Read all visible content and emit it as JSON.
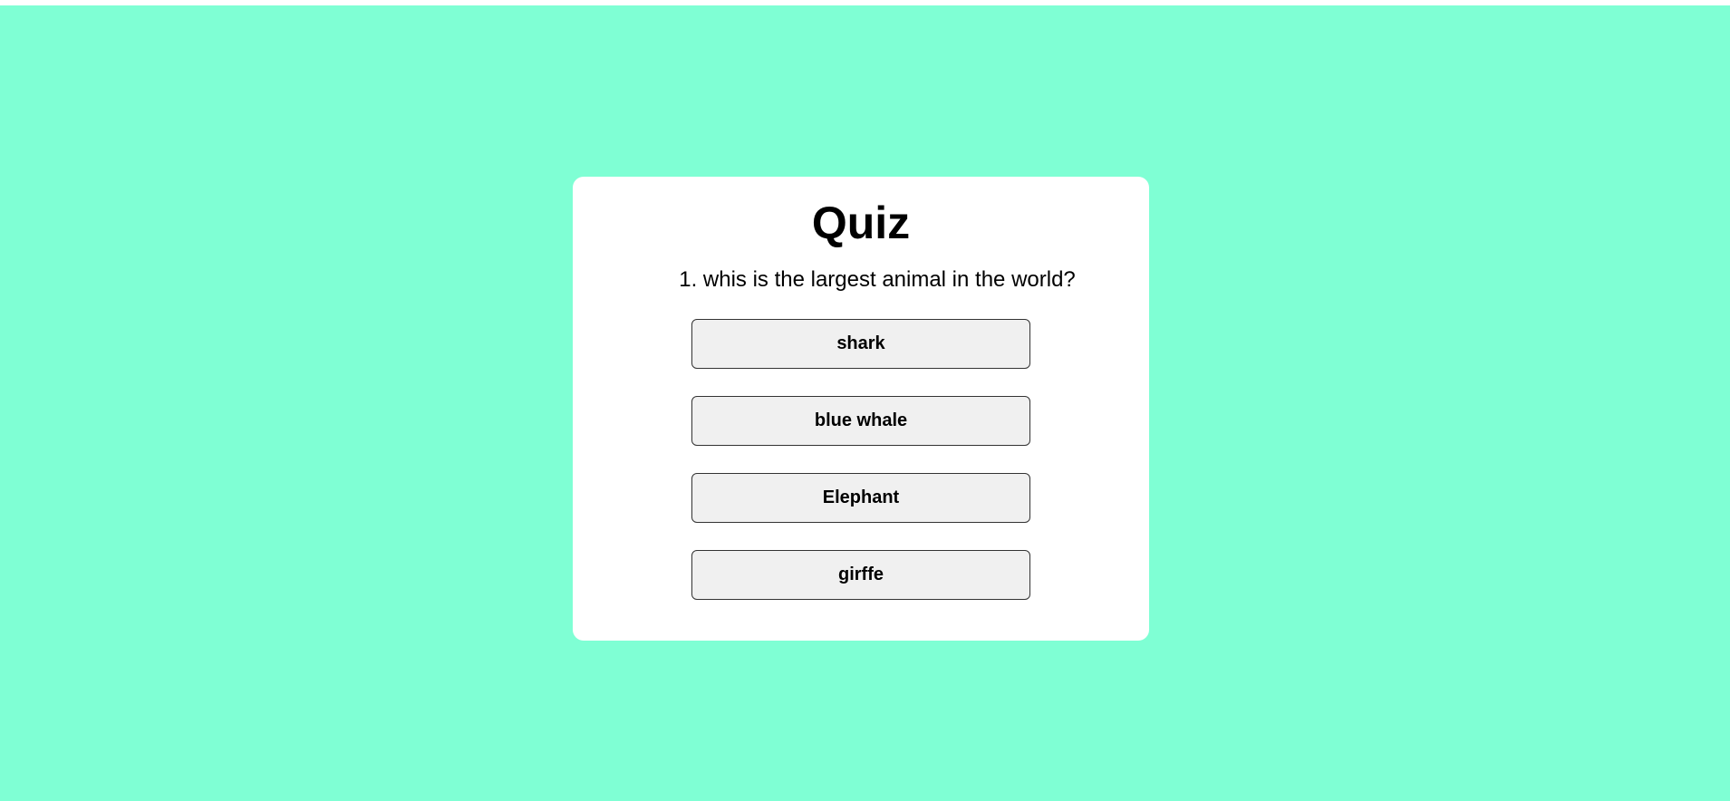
{
  "quiz": {
    "title": "Quiz",
    "question": "1. whis is the largest animal in the world?",
    "answers": [
      "shark",
      "blue whale",
      "Elephant",
      "girffe"
    ]
  },
  "colors": {
    "page_background": "#7fffd4",
    "card_background": "#ffffff",
    "button_background": "#f0f0f0"
  }
}
